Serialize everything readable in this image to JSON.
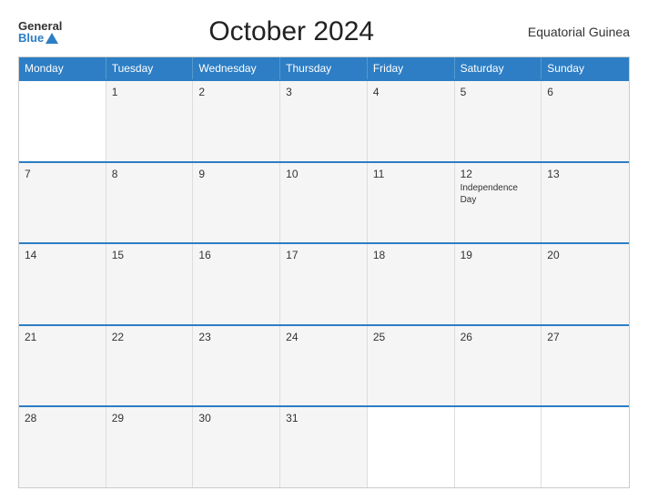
{
  "header": {
    "logo_general": "General",
    "logo_blue": "Blue",
    "title": "October 2024",
    "country": "Equatorial Guinea"
  },
  "days_of_week": [
    "Monday",
    "Tuesday",
    "Wednesday",
    "Thursday",
    "Friday",
    "Saturday",
    "Sunday"
  ],
  "weeks": [
    [
      {
        "num": "",
        "event": ""
      },
      {
        "num": "1",
        "event": ""
      },
      {
        "num": "2",
        "event": ""
      },
      {
        "num": "3",
        "event": ""
      },
      {
        "num": "4",
        "event": ""
      },
      {
        "num": "5",
        "event": ""
      },
      {
        "num": "6",
        "event": ""
      }
    ],
    [
      {
        "num": "7",
        "event": ""
      },
      {
        "num": "8",
        "event": ""
      },
      {
        "num": "9",
        "event": ""
      },
      {
        "num": "10",
        "event": ""
      },
      {
        "num": "11",
        "event": ""
      },
      {
        "num": "12",
        "event": "Independence Day"
      },
      {
        "num": "13",
        "event": ""
      }
    ],
    [
      {
        "num": "14",
        "event": ""
      },
      {
        "num": "15",
        "event": ""
      },
      {
        "num": "16",
        "event": ""
      },
      {
        "num": "17",
        "event": ""
      },
      {
        "num": "18",
        "event": ""
      },
      {
        "num": "19",
        "event": ""
      },
      {
        "num": "20",
        "event": ""
      }
    ],
    [
      {
        "num": "21",
        "event": ""
      },
      {
        "num": "22",
        "event": ""
      },
      {
        "num": "23",
        "event": ""
      },
      {
        "num": "24",
        "event": ""
      },
      {
        "num": "25",
        "event": ""
      },
      {
        "num": "26",
        "event": ""
      },
      {
        "num": "27",
        "event": ""
      }
    ],
    [
      {
        "num": "28",
        "event": ""
      },
      {
        "num": "29",
        "event": ""
      },
      {
        "num": "30",
        "event": ""
      },
      {
        "num": "31",
        "event": ""
      },
      {
        "num": "",
        "event": ""
      },
      {
        "num": "",
        "event": ""
      },
      {
        "num": "",
        "event": ""
      }
    ]
  ]
}
